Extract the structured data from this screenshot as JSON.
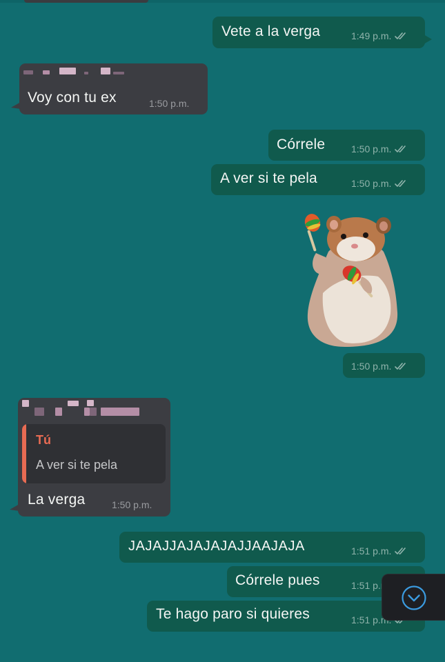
{
  "colors": {
    "wallpaper": "#116d70",
    "outgoing_bubble": "#105a4d",
    "incoming_bubble": "#3c3d42",
    "reply_accent": "#e86b53",
    "scroll_button_accent": "#3b9be0"
  },
  "messages": [
    {
      "direction": "outgoing",
      "text": "Vete a la verga",
      "time": "1:49 p.m.",
      "status": "double-tick-read"
    },
    {
      "direction": "incoming",
      "sender_name_blurred": true,
      "text": "Voy con tu ex",
      "time": "1:50 p.m."
    },
    {
      "direction": "outgoing",
      "text": "Córrele",
      "time": "1:50 p.m.",
      "status": "double-tick-read"
    },
    {
      "direction": "outgoing",
      "text": "A ver si te pela",
      "time": "1:50 p.m.",
      "status": "double-tick-read"
    },
    {
      "direction": "outgoing",
      "type": "sticker",
      "sticker": "hamster-with-maracas",
      "time": "1:50 p.m.",
      "status": "double-tick-read"
    },
    {
      "direction": "incoming",
      "sender_name_blurred": true,
      "reply_to": {
        "author": "Tú",
        "text": "A ver si te pela"
      },
      "text": "La verga",
      "time": "1:50 p.m."
    },
    {
      "direction": "outgoing",
      "text": "JAJAJJAJAJAJAJJAAJAJA",
      "time": "1:51 p.m.",
      "status": "double-tick-read"
    },
    {
      "direction": "outgoing",
      "text": "Córrele pues",
      "time": "1:51 p.m.",
      "status": "double-tick-read"
    },
    {
      "direction": "outgoing",
      "text": "Te hago paro si quieres",
      "time": "1:51 p.m.",
      "status": "double-tick-read"
    }
  ],
  "scroll_button": {
    "icon": "chevron-down-circle-icon"
  }
}
